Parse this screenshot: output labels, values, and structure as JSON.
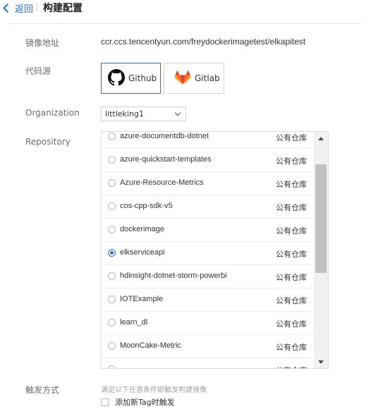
{
  "header": {
    "back_label": "返回",
    "title": "构建配置"
  },
  "form": {
    "image_address_label": "镜像地址",
    "image_address_value": "ccr.ccs.tencentyun.com/freydockerimagetest/elkapitest",
    "code_source_label": "代码源",
    "sources": [
      {
        "label": "Github",
        "icon": "github-icon",
        "selected": true
      },
      {
        "label": "Gitlab",
        "icon": "gitlab-icon",
        "selected": false
      }
    ],
    "organization_label": "Organization",
    "organization_value": "littleking1",
    "repository_label": "Repository",
    "repositories": [
      {
        "name": "azure-documentdb-dotnet",
        "tag": "公有仓库",
        "selected": false
      },
      {
        "name": "azure-quickstart-templates",
        "tag": "公有仓库",
        "selected": false
      },
      {
        "name": "Azure-Resource-Metrics",
        "tag": "公有仓库",
        "selected": false
      },
      {
        "name": "cos-cpp-sdk-v5",
        "tag": "公有仓库",
        "selected": false
      },
      {
        "name": "dockerimage",
        "tag": "公有仓库",
        "selected": false
      },
      {
        "name": "elkserviceapi",
        "tag": "公有仓库",
        "selected": true
      },
      {
        "name": "hdinsight-dotnet-storm-powerbi",
        "tag": "公有仓库",
        "selected": false
      },
      {
        "name": "IOTExample",
        "tag": "公有仓库",
        "selected": false
      },
      {
        "name": "learn_dl",
        "tag": "公有仓库",
        "selected": false
      },
      {
        "name": "MoonCake-Metric",
        "tag": "公有仓库",
        "selected": false
      },
      {
        "name": "",
        "tag": "公有仓库",
        "selected": false
      }
    ],
    "trigger_label": "触发方式",
    "trigger_hint": "满足以下任意条件即触发构建镜像",
    "trigger_option_label": "添加新Tag时触发",
    "trigger_option_checked": false
  },
  "colors": {
    "accent": "#2c6cc4",
    "link": "#1f6fc5",
    "gitlab_orange": "#e24329"
  }
}
